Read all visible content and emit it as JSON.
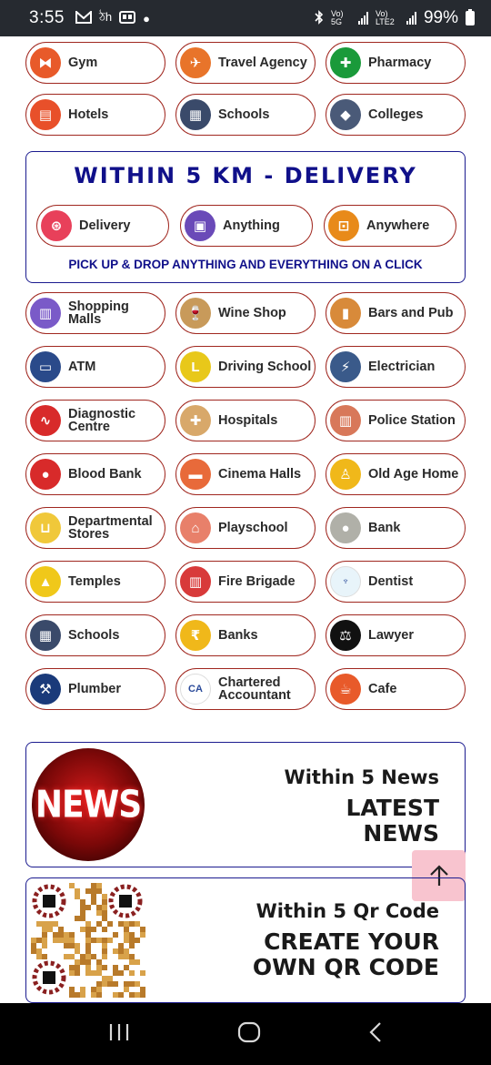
{
  "status": {
    "time": "3:55",
    "battery": "99%",
    "net1": "Vo) 5G",
    "net2": "Vo) LTE2"
  },
  "top_categories": [
    {
      "label": "Gym",
      "icon": "dumbbell-icon",
      "color": "#e85a2a"
    },
    {
      "label": "Travel Agency",
      "icon": "travel-icon",
      "color": "#e8742a"
    },
    {
      "label": "Pharmacy",
      "icon": "plus-cross-icon",
      "color": "#1a9a3a"
    },
    {
      "label": "Hotels",
      "icon": "hotel-icon",
      "color": "#e8502a"
    },
    {
      "label": "Schools",
      "icon": "school-icon",
      "color": "#3a4a6a"
    },
    {
      "label": "Colleges",
      "icon": "graduation-cap-icon",
      "color": "#4a5a78"
    }
  ],
  "delivery": {
    "title": "WITHIN 5 KM - DELIVERY",
    "items": [
      {
        "label": "Delivery",
        "icon": "delivery-scooter-icon",
        "color": "#e8405a"
      },
      {
        "label": "Anything",
        "icon": "package-icon",
        "color": "#6a4ab8"
      },
      {
        "label": "Anywhere",
        "icon": "car-icon",
        "color": "#e88a1a"
      }
    ],
    "footer": "PICK UP & DROP ANYTHING AND EVERYTHING ON A CLICK"
  },
  "categories": [
    {
      "label": "Shopping Malls",
      "icon": "mall-icon",
      "color": "#7a5ac8"
    },
    {
      "label": "Wine Shop",
      "icon": "wine-glass-icon",
      "color": "#c89a5a"
    },
    {
      "label": "Bars and Pub",
      "icon": "beer-icon",
      "color": "#d88a3a"
    },
    {
      "label": "ATM",
      "icon": "atm-icon",
      "color": "#2a4a8a"
    },
    {
      "label": "Driving School",
      "icon": "learner-car-icon",
      "color": "#e8c81a"
    },
    {
      "label": "Electrician",
      "icon": "electrician-icon",
      "color": "#3a5a8a"
    },
    {
      "label": "Diagnostic Centre",
      "icon": "pulse-icon",
      "color": "#d82a2a"
    },
    {
      "label": "Hospitals",
      "icon": "hospital-icon",
      "color": "#d8a86a"
    },
    {
      "label": "Police Station",
      "icon": "police-station-icon",
      "color": "#d8785a"
    },
    {
      "label": "Blood Bank",
      "icon": "blood-drop-icon",
      "color": "#d82a2a"
    },
    {
      "label": "Cinema Halls",
      "icon": "cinema-icon",
      "color": "#e86a3a"
    },
    {
      "label": "Old Age Home",
      "icon": "elderly-icon",
      "color": "#f0b81a"
    },
    {
      "label": "Departmental Stores",
      "icon": "cart-icon",
      "color": "#f0c83a"
    },
    {
      "label": "Playschool",
      "icon": "house-icon",
      "color": "#e8806a"
    },
    {
      "label": "Bank",
      "icon": "piggy-bank-icon",
      "color": "#b0b0a8"
    },
    {
      "label": "Temples",
      "icon": "temple-icon",
      "color": "#f0c81a"
    },
    {
      "label": "Fire Brigade",
      "icon": "fire-station-icon",
      "color": "#d83a3a"
    },
    {
      "label": "Dentist",
      "icon": "tooth-icon",
      "color": "#e8f4fa"
    },
    {
      "label": "Schools",
      "icon": "school-icon",
      "color": "#3a4a6a"
    },
    {
      "label": "Banks",
      "icon": "rupee-icon",
      "color": "#f0b81a"
    },
    {
      "label": "Lawyer",
      "icon": "lawyer-icon",
      "color": "#111111"
    },
    {
      "label": "Plumber",
      "icon": "plumber-icon",
      "color": "#1a3a7a"
    },
    {
      "label": "Chartered Accountant",
      "icon": "ca-icon",
      "color": "#ffffff"
    },
    {
      "label": "Cafe",
      "icon": "coffee-cup-icon",
      "color": "#e85a2a"
    }
  ],
  "news": {
    "badge": "NEWS",
    "subtitle": "Within 5 News",
    "headline_line1": "LATEST",
    "headline_line2": "NEWS"
  },
  "qr": {
    "subtitle": "Within 5 Qr Code",
    "headline_line1": "CREATE YOUR",
    "headline_line2": "OWN QR CODE"
  }
}
